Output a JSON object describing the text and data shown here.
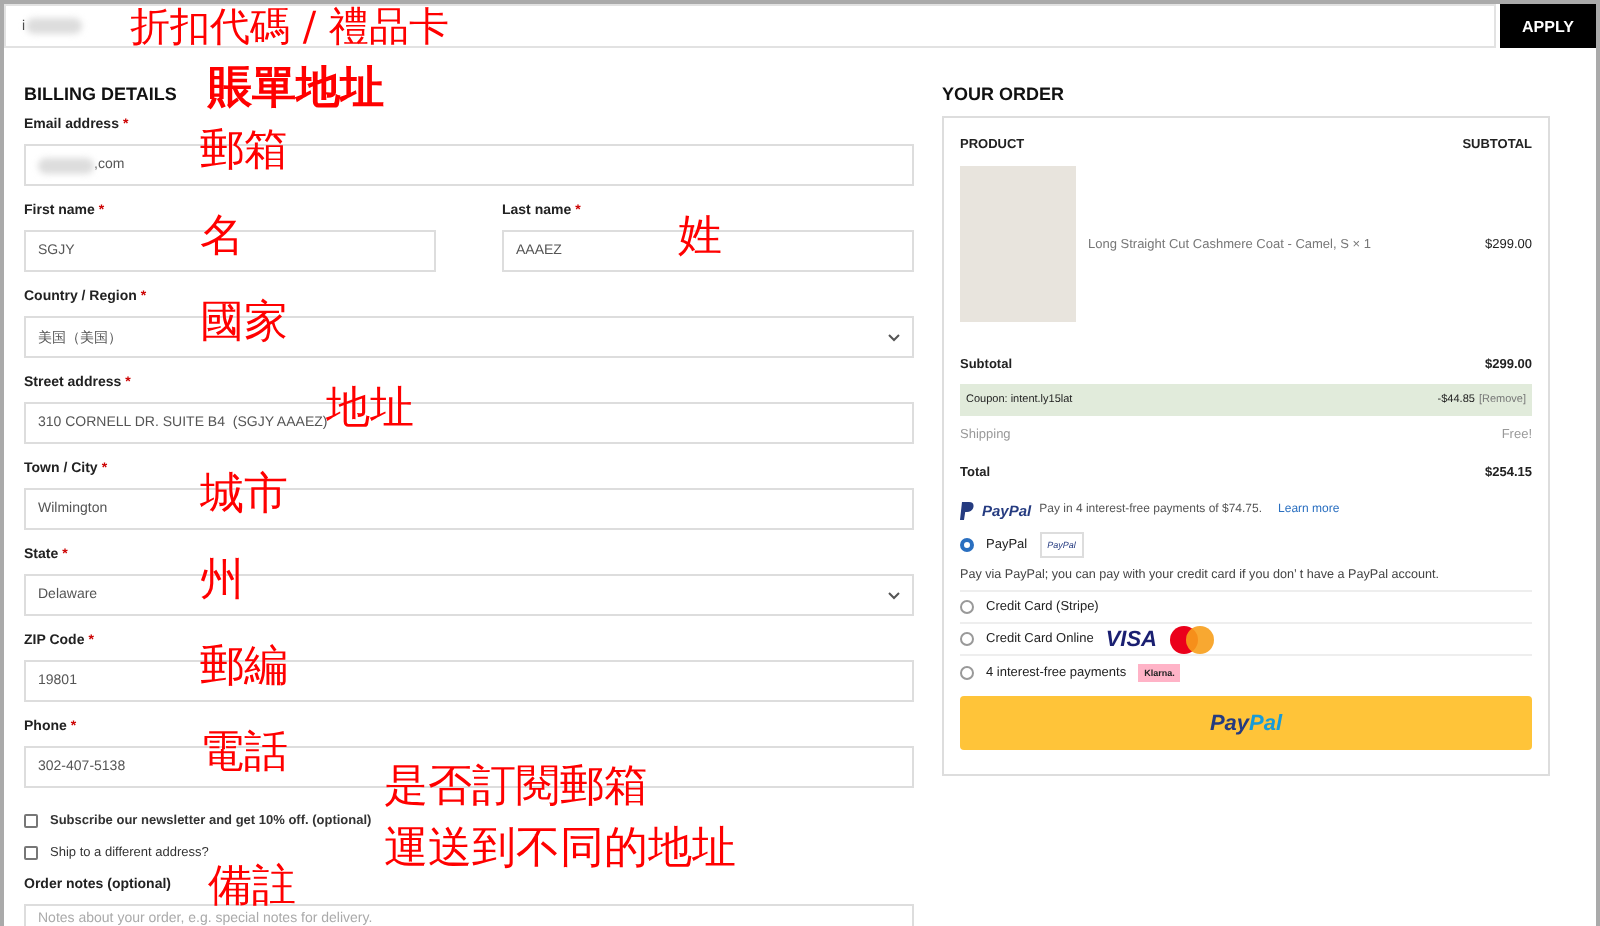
{
  "coupon": {
    "value": "i",
    "annotation": "折扣代碼 / 禮品卡",
    "button": "APPLY"
  },
  "billing": {
    "title": "BILLING DETAILS",
    "annotation": "賬單地址",
    "rows": [
      [
        {
          "kind": "input",
          "label": "Email address",
          "required": "*",
          "value": ",com",
          "redacted": true,
          "annotation": "郵箱"
        }
      ],
      [
        {
          "kind": "input",
          "label": "First name",
          "required": "*",
          "value": "SGJY",
          "annotation": "名"
        },
        {
          "kind": "input",
          "label": "Last name",
          "required": "*",
          "value": "AAAEZ",
          "annotation": "姓"
        }
      ],
      [
        {
          "kind": "select",
          "label": "Country / Region",
          "required": "*",
          "value": "美国（美国）",
          "annotation": "國家"
        }
      ],
      [
        {
          "kind": "input",
          "label": "Street address",
          "required": "*",
          "value": "310 CORNELL DR. SUITE B4  (SGJY AAAEZ)",
          "annotation": "地址"
        }
      ],
      [
        {
          "kind": "input",
          "label": "Town / City",
          "required": "*",
          "value": "Wilmington",
          "annotation": "城市"
        }
      ],
      [
        {
          "kind": "select",
          "label": "State",
          "required": "*",
          "value": "Delaware",
          "annotation": "州"
        }
      ],
      [
        {
          "kind": "input",
          "label": "ZIP Code",
          "required": "*",
          "value": "19801",
          "annotation": "郵編"
        }
      ],
      [
        {
          "kind": "input",
          "label": "Phone",
          "required": "*",
          "value": "302-407-5138",
          "annotation": "電話"
        }
      ]
    ],
    "checkboxes": [
      {
        "label": "Subscribe our newsletter and get 10% off. (optional)",
        "checked": false,
        "annotation": "是否訂閱郵箱"
      },
      {
        "label": "Ship to a different address?",
        "checked": false,
        "annotation": "運送到不同的地址"
      }
    ],
    "notes": {
      "label": "Order notes (optional)",
      "placeholder": "Notes about your order, e.g. special notes for delivery.",
      "annotation": "備註"
    }
  },
  "order": {
    "title": "YOUR ORDER",
    "columns": [
      "PRODUCT",
      "SUBTOTAL"
    ],
    "product": {
      "name": "Long Straight Cut Cashmere Coat - Camel, S",
      "quantity": "× 1",
      "price": "$299.00"
    },
    "totals": [
      {
        "kind": "plain",
        "label": "Subtotal",
        "value": "$299.00"
      },
      {
        "kind": "coupon",
        "label": "Coupon: intent.ly15lat",
        "value": "-$44.85",
        "link": "[Remove]"
      },
      {
        "kind": "muted",
        "label": "Shipping",
        "value": "Free!"
      },
      {
        "kind": "plain",
        "label": "Total",
        "value": "$254.15"
      }
    ],
    "paylater": {
      "logo": "PayPal",
      "text": "Pay in 4 interest-free payments of $74.75.",
      "link": "Learn more"
    },
    "methods": [
      {
        "kind": "paypal",
        "label": "PayPal",
        "badge": "PayPal",
        "selected": true,
        "description": "Pay via PayPal; you can pay with your credit card if you don’ t have a PayPal account."
      },
      {
        "kind": "plain",
        "label": "Credit Card (Stripe)",
        "selected": false
      },
      {
        "kind": "cards",
        "label": "Credit Card Online",
        "badge": "VISA",
        "selected": false
      },
      {
        "kind": "klarna",
        "label": "4 interest-free payments",
        "badge": "Klarna.",
        "selected": false
      }
    ],
    "paypal_button": {
      "first": "Pay",
      "second": "Pal"
    }
  }
}
